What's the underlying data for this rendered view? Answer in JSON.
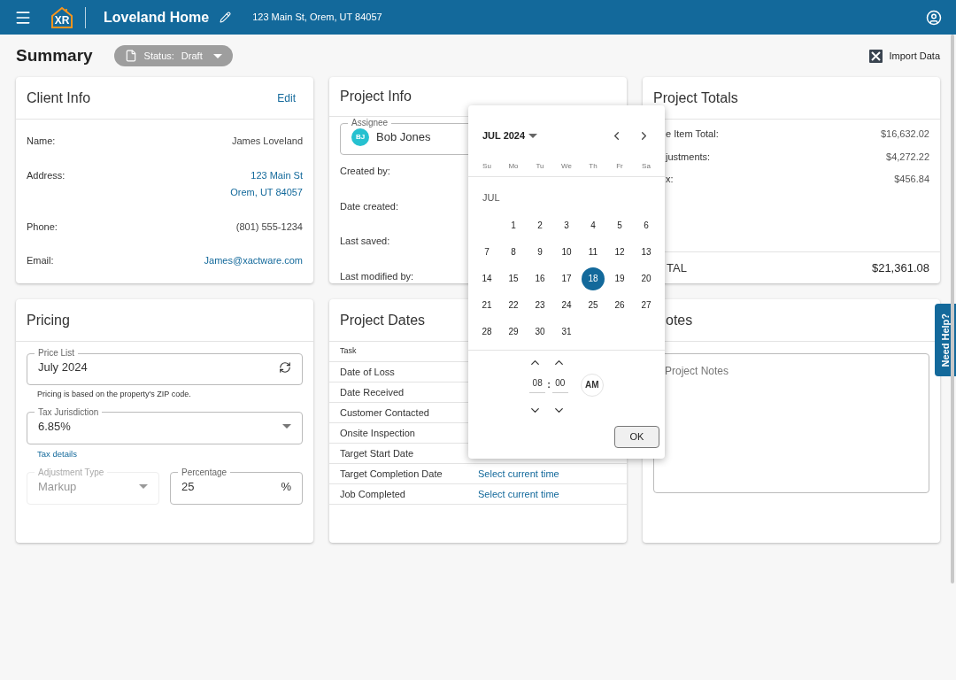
{
  "topbar": {
    "logo_text": "XR",
    "project_name": "Loveland Home",
    "address": "123 Main St, Orem, UT 84057"
  },
  "summary": {
    "title": "Summary",
    "status_label": "Status:",
    "status_value": "Draft",
    "import_label": "Import Data"
  },
  "client_info": {
    "title": "Client Info",
    "edit": "Edit",
    "rows": [
      {
        "label": "Name:",
        "kind": "text",
        "lines": [
          "James Loveland"
        ]
      },
      {
        "label": "Address:",
        "kind": "link",
        "lines": [
          "123 Main St",
          "Orem, UT 84057"
        ]
      },
      {
        "label": "Phone:",
        "kind": "text",
        "lines": [
          "(801) 555-1234"
        ]
      },
      {
        "label": "Email:",
        "kind": "link",
        "lines": [
          "James@xactware.com"
        ]
      }
    ]
  },
  "project_info": {
    "title": "Project Info",
    "assignee_label": "Assignee",
    "assignee_initials": "BJ",
    "assignee_name": "Bob Jones",
    "rows": [
      "Created by:",
      "Date created:",
      "Last saved:",
      "Last modified by:"
    ]
  },
  "project_totals": {
    "title": "Project Totals",
    "rows": [
      {
        "label": "e Item Total:",
        "value": "$16,632.02"
      },
      {
        "label": "justments:",
        "value": "$4,272.22"
      },
      {
        "label": "x:",
        "value": "$456.84"
      }
    ],
    "total_label": "TAL",
    "total_value": "$21,361.08"
  },
  "pricing": {
    "title": "Pricing",
    "price_list_label": "Price List",
    "price_list_value": "July 2024",
    "helper": "Pricing is based on the property's ZIP code.",
    "tax_label": "Tax Jurisdiction",
    "tax_value": "6.85%",
    "tax_link": "Tax details",
    "adjustment_label": "Adjustment Type",
    "adjustment_value": "Markup",
    "adjustment_disabled": true,
    "percentage_label": "Percentage",
    "percentage_value": "25",
    "percentage_unit": "%"
  },
  "project_dates": {
    "title": "Project Dates",
    "column": "Task",
    "rows": [
      {
        "task": "Date of Loss"
      },
      {
        "task": "Date Received"
      },
      {
        "task": "Customer Contacted"
      },
      {
        "task": "Onsite Inspection"
      },
      {
        "task": "Target Start Date"
      },
      {
        "task": "Target Completion Date",
        "value": "Select current time"
      },
      {
        "task": "Job Completed",
        "value": "Select current time"
      }
    ]
  },
  "notes": {
    "title": "otes",
    "placeholder": "Project Notes"
  },
  "help_tab": "Need Help?",
  "date_picker": {
    "month": "JUL 2024",
    "weekdays": [
      "Su",
      "Mo",
      "Tu",
      "We",
      "Th",
      "Fr",
      "Sa"
    ],
    "section": "JUL",
    "weeks": [
      [
        {
          "day": "1",
          "selected": false
        },
        {
          "day": "2",
          "selected": false
        },
        {
          "day": "3",
          "selected": false
        },
        {
          "day": "4",
          "selected": false
        },
        {
          "day": "5",
          "selected": false
        },
        {
          "day": "6",
          "selected": false
        }
      ],
      [
        {
          "day": "7",
          "selected": false
        },
        {
          "day": "8",
          "selected": false
        },
        {
          "day": "9",
          "selected": false
        },
        {
          "day": "10",
          "selected": false
        },
        {
          "day": "11",
          "selected": false
        },
        {
          "day": "12",
          "selected": false
        },
        {
          "day": "13",
          "selected": false
        }
      ],
      [
        {
          "day": "14",
          "selected": false
        },
        {
          "day": "15",
          "selected": false
        },
        {
          "day": "16",
          "selected": false
        },
        {
          "day": "17",
          "selected": false
        },
        {
          "day": "18",
          "selected": true
        },
        {
          "day": "19",
          "selected": false
        },
        {
          "day": "20",
          "selected": false
        }
      ],
      [
        {
          "day": "21",
          "selected": false
        },
        {
          "day": "22",
          "selected": false
        },
        {
          "day": "23",
          "selected": false
        },
        {
          "day": "24",
          "selected": false
        },
        {
          "day": "25",
          "selected": false
        },
        {
          "day": "26",
          "selected": false
        },
        {
          "day": "27",
          "selected": false
        }
      ],
      [
        {
          "day": "28",
          "selected": false
        },
        {
          "day": "29",
          "selected": false
        },
        {
          "day": "30",
          "selected": false
        },
        {
          "day": "31",
          "selected": false
        }
      ]
    ],
    "hour": "08",
    "separator": ":",
    "minute": "00",
    "meridiem": "AM",
    "ok": "OK"
  }
}
